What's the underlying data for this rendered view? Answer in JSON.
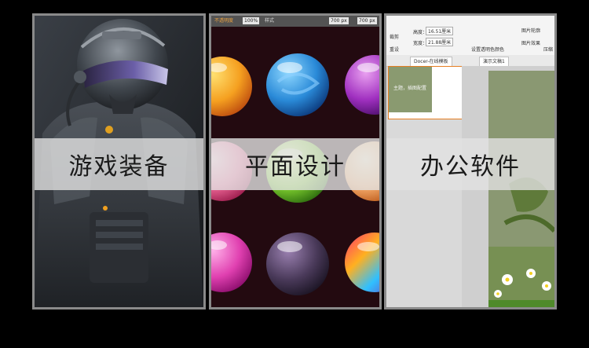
{
  "panels": [
    {
      "label": "游戏装备"
    },
    {
      "label": "平面设计"
    },
    {
      "label": "办公软件"
    }
  ],
  "design_toolbar": {
    "stroke_label": "不透明度",
    "opacity_value": "100%",
    "style_label": "样式",
    "w_value": "700 px",
    "h_value": "700 px"
  },
  "office": {
    "height_label": "高度：",
    "height_value": "16.51厘米",
    "width_label": "宽度：",
    "width_value": "21.88厘米",
    "transparent_color": "设置透明色",
    "color_label": "颜色",
    "outline_label": "图片轮廓",
    "effect_label": "图片效果",
    "compress_label": "压缩",
    "crop_label": "裁剪",
    "reset_label": "重设",
    "tab_docer": "Docer-在线模板",
    "tab_doc": "演示文稿1",
    "thumb_text": "主题，插图配置"
  },
  "colors": {
    "banner_bg": "#e1e1e1",
    "panel_border": "#8a8a8a"
  }
}
